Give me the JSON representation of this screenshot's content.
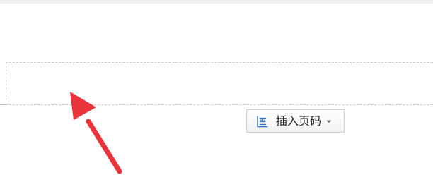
{
  "toolbar": {
    "insert_page_number_label": "插入页码",
    "icon": "page-number-icon",
    "dropdown_icon": "chevron-down-icon"
  },
  "annotation": {
    "icon": "red-arrow-icon",
    "color": "#e8343a"
  },
  "colors": {
    "icon_blue": "#2b72d6",
    "guide_line": "#c9c9c9",
    "button_border": "#cfcfcf"
  }
}
